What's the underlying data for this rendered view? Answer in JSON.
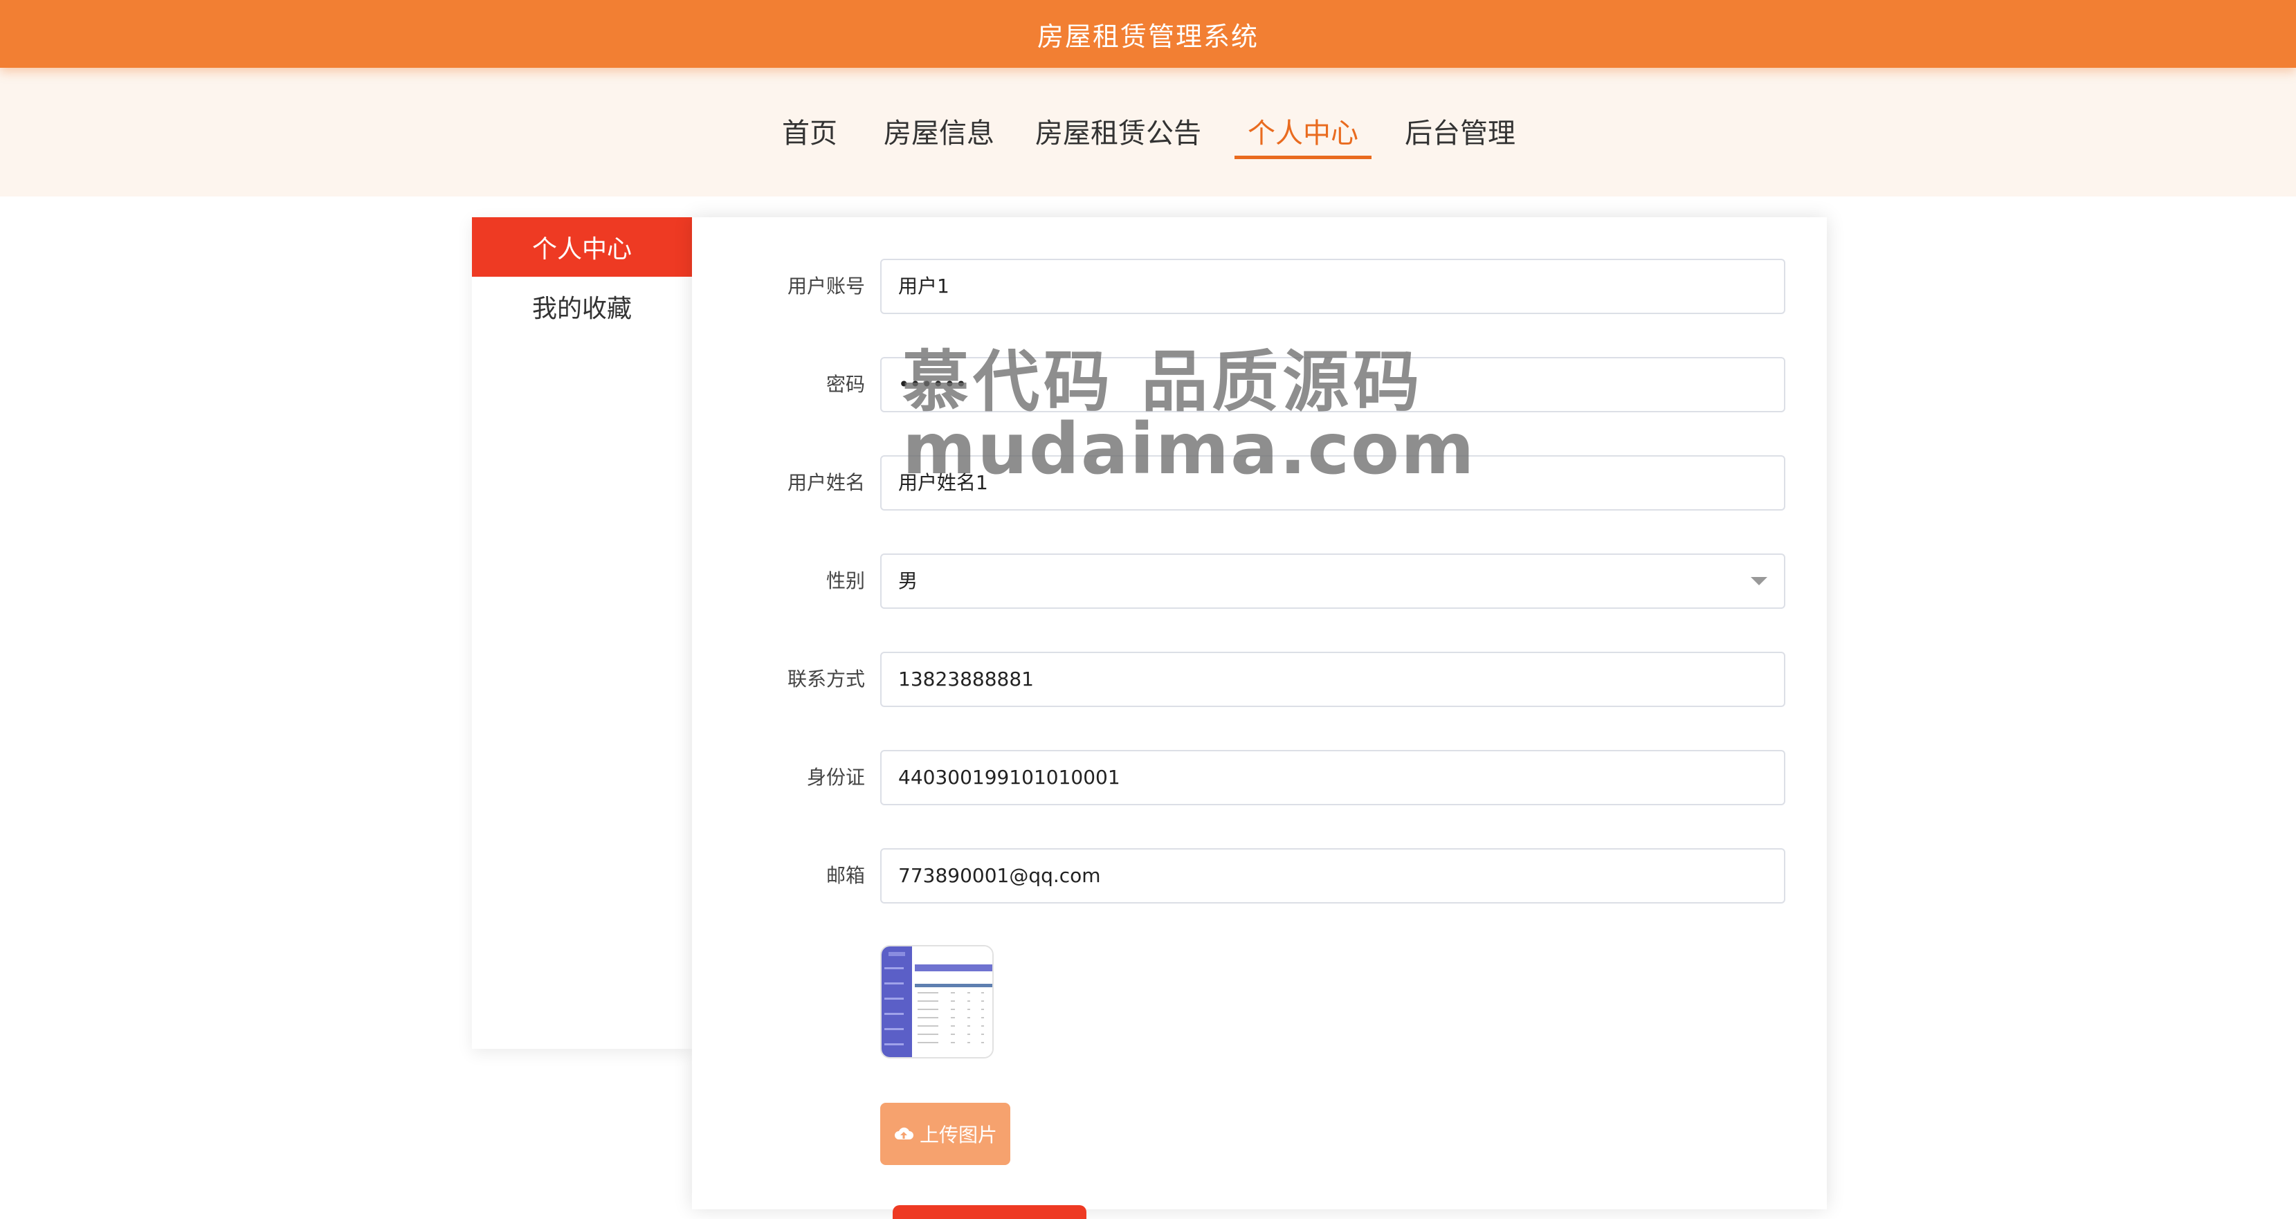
{
  "header": {
    "title": "房屋租赁管理系统"
  },
  "nav": {
    "items": [
      {
        "label": "首页"
      },
      {
        "label": "房屋信息"
      },
      {
        "label": "房屋租赁公告"
      },
      {
        "label": "个人中心"
      },
      {
        "label": "后台管理"
      }
    ],
    "active": "个人中心"
  },
  "side": {
    "items": [
      {
        "label": "个人中心"
      },
      {
        "label": "我的收藏"
      }
    ],
    "active": "个人中心"
  },
  "form": {
    "account": {
      "label": "用户账号",
      "value": "用户1"
    },
    "password": {
      "label": "密码",
      "value": "••••••"
    },
    "name": {
      "label": "用户姓名",
      "value": "用户姓名1"
    },
    "gender": {
      "label": "性别",
      "value": "男"
    },
    "phone": {
      "label": "联系方式",
      "value": "13823888881"
    },
    "idcard": {
      "label": "身份证",
      "value": "440300199101010001"
    },
    "email": {
      "label": "邮箱",
      "value": "773890001@qq.com"
    }
  },
  "upload": {
    "label": "上传图片",
    "icon": "cloud-upload-icon"
  },
  "watermark": {
    "line1": "慕代码 品质源码",
    "line2": "mudaima.com"
  },
  "colors": {
    "header": "#f27f33",
    "nav_active": "#e96b1f",
    "side_active": "#ee3a23",
    "upload": "#f6a26e"
  }
}
